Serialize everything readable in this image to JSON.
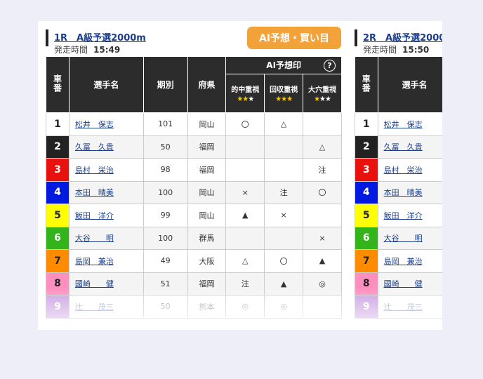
{
  "race1": {
    "title": "1R　A級予選2000m",
    "time_label": "発走時間",
    "time": "15:49",
    "ai_button": "AI予想・買い目",
    "headers": {
      "car": "車番",
      "name": "選手名",
      "term": "期別",
      "pref": "府県",
      "ai": "AI予想印",
      "help": "?",
      "col1": "的中重視",
      "col2": "回収重視",
      "col3": "大穴重視",
      "star1": "★★★",
      "star2": "★★★",
      "star3": "★★★"
    },
    "rows": [
      {
        "num": "1",
        "name": "松井　保志",
        "term": "101",
        "pref": "岡山",
        "m1": "〇",
        "m2": "△",
        "m3": ""
      },
      {
        "num": "2",
        "name": "久冨　久貴",
        "term": "50",
        "pref": "福岡",
        "m1": "",
        "m2": "",
        "m3": "△"
      },
      {
        "num": "3",
        "name": "島村　栄治",
        "term": "98",
        "pref": "福岡",
        "m1": "",
        "m2": "",
        "m3": "注"
      },
      {
        "num": "4",
        "name": "本田　晴美",
        "term": "100",
        "pref": "岡山",
        "m1": "×",
        "m2": "注",
        "m3": "〇"
      },
      {
        "num": "5",
        "name": "飯田　洋介",
        "term": "99",
        "pref": "岡山",
        "m1": "▲",
        "m2": "×",
        "m3": ""
      },
      {
        "num": "6",
        "name": "大谷　　明",
        "term": "100",
        "pref": "群馬",
        "m1": "",
        "m2": "",
        "m3": "×"
      },
      {
        "num": "7",
        "name": "島岡　兼治",
        "term": "49",
        "pref": "大阪",
        "m1": "△",
        "m2": "〇",
        "m3": "▲"
      },
      {
        "num": "8",
        "name": "國崎　　健",
        "term": "51",
        "pref": "福岡",
        "m1": "注",
        "m2": "▲",
        "m3": "◎"
      },
      {
        "num": "9",
        "name": "辻　　茂三",
        "term": "50",
        "pref": "熊本",
        "m1": "◎",
        "m2": "◎",
        "m3": ""
      }
    ]
  },
  "race2": {
    "title": "2R　A級予選2000",
    "time_label": "発走時間",
    "time": "15:50",
    "headers": {
      "car": "車番",
      "name": "選手名"
    },
    "rows": [
      {
        "num": "1",
        "name": "松井　保志"
      },
      {
        "num": "2",
        "name": "久冨　久貴"
      },
      {
        "num": "3",
        "name": "島村　栄治"
      },
      {
        "num": "4",
        "name": "本田　晴美"
      },
      {
        "num": "5",
        "name": "飯田　洋介"
      },
      {
        "num": "6",
        "name": "大谷　　明"
      },
      {
        "num": "7",
        "name": "島岡　兼治"
      },
      {
        "num": "8",
        "name": "國崎　　健"
      },
      {
        "num": "9",
        "name": "辻　　茂三"
      }
    ]
  },
  "colors": {
    "car": [
      "#ffffff",
      "#222222",
      "#e8110e",
      "#0019e0",
      "#ffff00",
      "#32b41a",
      "#ff8c00",
      "#ff8fbf",
      "#8d2ebf"
    ],
    "car_text": [
      "#222222",
      "#ffffff",
      "#ffffff",
      "#ffffff",
      "#222222",
      "#ffffff",
      "#222222",
      "#222222",
      "#ffffff"
    ],
    "accent": "#f3a23a",
    "header_bg": "#2c2c2c",
    "link": "#1b3f8b"
  }
}
